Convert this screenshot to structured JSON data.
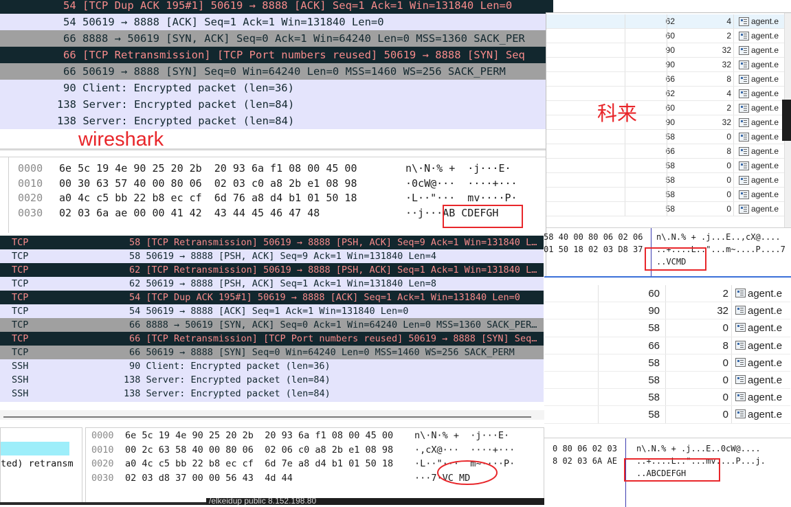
{
  "wireshark_top": {
    "packets": [
      {
        "text": "54 [TCP Dup ACK 195#1] 50619 → 8888 [ACK] Seq=1 Ack=1 Win=131840 Len=0",
        "style": "dark"
      },
      {
        "text": "54 50619 → 8888 [ACK] Seq=1 Ack=1 Win=131840 Len=0",
        "style": "lav"
      },
      {
        "text": "66 8888 → 50619 [SYN, ACK] Seq=0 Ack=1 Win=64240 Len=0 MSS=1360 SACK_PER",
        "style": "gray"
      },
      {
        "text": "66 [TCP Retransmission] [TCP Port numbers reused] 50619 → 8888 [SYN] Seq",
        "style": "dark"
      },
      {
        "text": "66 50619 → 8888 [SYN] Seq=0 Win=64240 Len=0 MSS=1460 WS=256 SACK_PERM",
        "style": "gray"
      },
      {
        "text": "90 Client: Encrypted packet (len=36)",
        "style": "lav"
      },
      {
        "text": "138 Server: Encrypted packet (len=84)",
        "style": "lav"
      },
      {
        "text": "138 Server: Encrypted packet (len=84)",
        "style": "lav"
      }
    ],
    "annotation": "wireshark",
    "hex": {
      "offsets": [
        "0000",
        "0010",
        "0020",
        "0030"
      ],
      "bytes": [
        "6e 5c 19 4e 90 25 20 2b  20 93 6a f1 08 00 45 00",
        "00 30 63 57 40 00 80 06  02 03 c0 a8 2b e1 08 98",
        "a0 4c c5 bb 22 b8 ec cf  6d 76 a8 d4 b1 01 50 18",
        "02 03 6a ae 00 00 41 42  43 44 45 46 47 48"
      ],
      "ascii": [
        "n\\·N·% +  ·j···E·",
        "·0cW@···  ····+···",
        "·L··\"···  mv····P·",
        "··j···AB CDEFGH"
      ]
    }
  },
  "wireshark_bottom": {
    "packets": [
      {
        "proto": "TCP",
        "info": "58 [TCP Retransmission] 50619 → 8888 [PSH, ACK] Seq=9 Ack=1 Win=131840 L…",
        "style": "dark"
      },
      {
        "proto": "TCP",
        "info": "58 50619 → 8888 [PSH, ACK] Seq=9 Ack=1 Win=131840 Len=4",
        "style": "lav"
      },
      {
        "proto": "TCP",
        "info": "62 [TCP Retransmission] 50619 → 8888 [PSH, ACK] Seq=1 Ack=1 Win=131840 L…",
        "style": "dark"
      },
      {
        "proto": "TCP",
        "info": "62 50619 → 8888 [PSH, ACK] Seq=1 Ack=1 Win=131840 Len=8",
        "style": "lav"
      },
      {
        "proto": "TCP",
        "info": "54 [TCP Dup ACK 195#1] 50619 → 8888 [ACK] Seq=1 Ack=1 Win=131840 Len=0",
        "style": "dark"
      },
      {
        "proto": "TCP",
        "info": "54 50619 → 8888 [ACK] Seq=1 Ack=1 Win=131840 Len=0",
        "style": "lav"
      },
      {
        "proto": "TCP",
        "info": "66 8888 → 50619 [SYN, ACK] Seq=0 Ack=1 Win=64240 Len=0 MSS=1360 SACK_PER…",
        "style": "gray"
      },
      {
        "proto": "TCP",
        "info": "66 [TCP Retransmission] [TCP Port numbers reused] 50619 → 8888 [SYN] Seq…",
        "style": "dark"
      },
      {
        "proto": "TCP",
        "info": "66 50619 → 8888 [SYN] Seq=0 Win=64240 Len=0 MSS=1460 WS=256 SACK_PERM",
        "style": "gray"
      },
      {
        "proto": "SSH",
        "info": "90 Client: Encrypted packet (len=36)",
        "style": "lav"
      },
      {
        "proto": "SSH",
        "info": "138 Server: Encrypted packet (len=84)",
        "style": "lav"
      },
      {
        "proto": "SSH",
        "info": "138 Server: Encrypted packet (len=84)",
        "style": "lav"
      }
    ],
    "detail_text": "ted) retransm",
    "hex": {
      "offsets": [
        "0000",
        "0010",
        "0020",
        "0030"
      ],
      "bytes": [
        "6e 5c 19 4e 90 25 20 2b  20 93 6a f1 08 00 45 00",
        "00 2c 63 58 40 00 80 06  02 06 c0 a8 2b e1 08 98",
        "a0 4c c5 bb 22 b8 ec cf  6d 7e a8 d4 b1 01 50 18",
        "02 03 d8 37 00 00 56 43  4d 44"
      ],
      "ascii": [
        "n\\·N·% +  ·j···E·",
        "·,cX@···  ····+···",
        "·L··\"···  m~····P·",
        "···7·VC MD"
      ]
    }
  },
  "kelai_top": {
    "annotation": "科来",
    "rows": [
      {
        "size": "62",
        "payload": "4",
        "process": "agent.e"
      },
      {
        "size": "60",
        "payload": "2",
        "process": "agent.e"
      },
      {
        "size": "90",
        "payload": "32",
        "process": "agent.e"
      },
      {
        "size": "90",
        "payload": "32",
        "process": "agent.e"
      },
      {
        "size": "66",
        "payload": "8",
        "process": "agent.e"
      },
      {
        "size": "62",
        "payload": "4",
        "process": "agent.e"
      },
      {
        "size": "60",
        "payload": "2",
        "process": "agent.e"
      },
      {
        "size": "90",
        "payload": "32",
        "process": "agent.e"
      },
      {
        "size": "58",
        "payload": "0",
        "process": "agent.e"
      },
      {
        "size": "66",
        "payload": "8",
        "process": "agent.e"
      },
      {
        "size": "58",
        "payload": "0",
        "process": "agent.e"
      },
      {
        "size": "58",
        "payload": "0",
        "process": "agent.e"
      },
      {
        "size": "58",
        "payload": "0",
        "process": "agent.e"
      },
      {
        "size": "58",
        "payload": "0",
        "process": "agent.e"
      }
    ],
    "hex_lines": [
      "58 40 00 80 06 02 06",
      "01 50 18 02 03 D8 37"
    ],
    "ascii_lines": [
      "n\\.N.% + .j...E..,cX@....",
      "..+....L..\"...m~....P....7",
      "..VCMD"
    ]
  },
  "kelai_bottom": {
    "rows": [
      {
        "size": "60",
        "payload": "2",
        "process": "agent.e"
      },
      {
        "size": "90",
        "payload": "32",
        "process": "agent.e"
      },
      {
        "size": "58",
        "payload": "0",
        "process": "agent.e"
      },
      {
        "size": "66",
        "payload": "8",
        "process": "agent.e"
      },
      {
        "size": "58",
        "payload": "0",
        "process": "agent.e"
      },
      {
        "size": "58",
        "payload": "0",
        "process": "agent.e"
      },
      {
        "size": "58",
        "payload": "0",
        "process": "agent.e"
      },
      {
        "size": "58",
        "payload": "0",
        "process": "agent.e"
      }
    ],
    "hex_lines": [
      "0 80 06 02 03",
      "8 02 03 6A AE"
    ],
    "ascii_lines": [
      "n\\.N.% + .j...E..0cW@....",
      "..+....L..\"...mv....P...j.",
      "..ABCDEFGH"
    ]
  },
  "bottom_strip_text": "/elkeidup public 8.152.198.80",
  "colors": {
    "dark_row": "#12272e",
    "dark_row_text": "#f78b8b",
    "gray_row": "#a0a0a0",
    "lavender_row": "#e4e4fc",
    "annotation_red": "#e8262a"
  }
}
